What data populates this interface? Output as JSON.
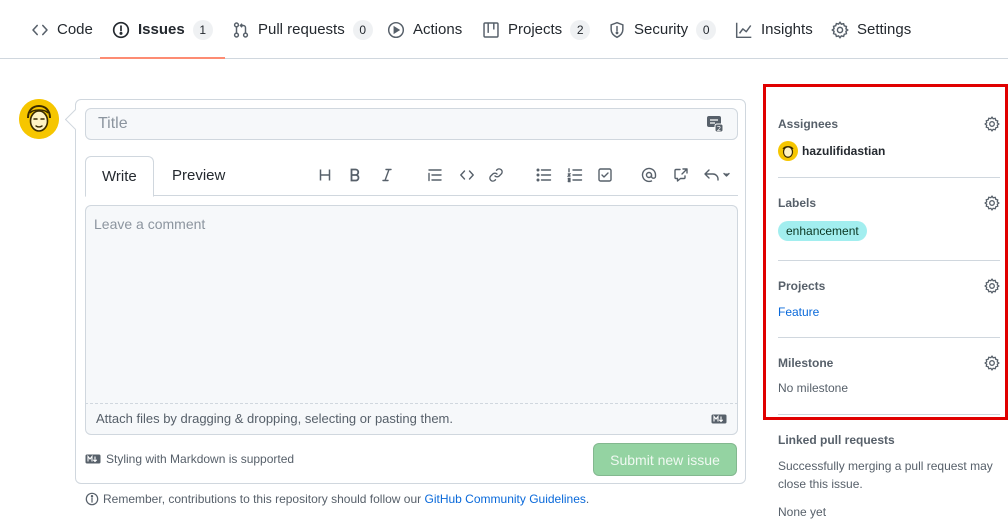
{
  "repo_nav": {
    "tabs": [
      {
        "label": "Code",
        "icon": "code-icon"
      },
      {
        "label": "Issues",
        "icon": "issue-opened-icon",
        "count": "1",
        "selected": true
      },
      {
        "label": "Pull requests",
        "icon": "git-pull-request-icon",
        "count": "0"
      },
      {
        "label": "Actions",
        "icon": "play-icon"
      },
      {
        "label": "Projects",
        "icon": "table-icon",
        "count": "2"
      },
      {
        "label": "Security",
        "icon": "shield-icon",
        "count": "0"
      },
      {
        "label": "Insights",
        "icon": "graph-icon"
      },
      {
        "label": "Settings",
        "icon": "gear-icon"
      }
    ],
    "selected_underline_color": "#fd8c73"
  },
  "issue_form": {
    "title_placeholder": "Title",
    "editor_tabs": [
      "Write",
      "Preview"
    ],
    "toolbar": [
      "heading-icon",
      "bold-icon",
      "italic-icon",
      "quote-icon",
      "code-icon",
      "link-icon",
      "unordered-list-icon",
      "ordered-list-icon",
      "tasklist-icon",
      "mention-icon",
      "cross-reference-icon",
      "reply-icon"
    ],
    "comment_placeholder": "Leave a comment",
    "attach_text": "Attach files by dragging & dropping, selecting or pasting them.",
    "markdown_note": "Styling with Markdown is supported",
    "submit_label": "Submit new issue",
    "submit_color": "#94d3a2",
    "guidelines_prefix": "Remember, contributions to this repository should follow our ",
    "guidelines_link": "GitHub Community Guidelines",
    "guidelines_suffix": "."
  },
  "sidebar": {
    "assignees": {
      "heading": "Assignees",
      "user": "hazulifidastian"
    },
    "labels": {
      "heading": "Labels",
      "label": "enhancement",
      "label_color": "#a2eeef"
    },
    "projects": {
      "heading": "Projects",
      "project": "Feature"
    },
    "milestone": {
      "heading": "Milestone",
      "value": "No milestone"
    },
    "linked_prs": {
      "heading": "Linked pull requests",
      "description": "Successfully merging a pull request may close this issue.",
      "value": "None yet"
    },
    "highlight_color": "#e00000"
  }
}
